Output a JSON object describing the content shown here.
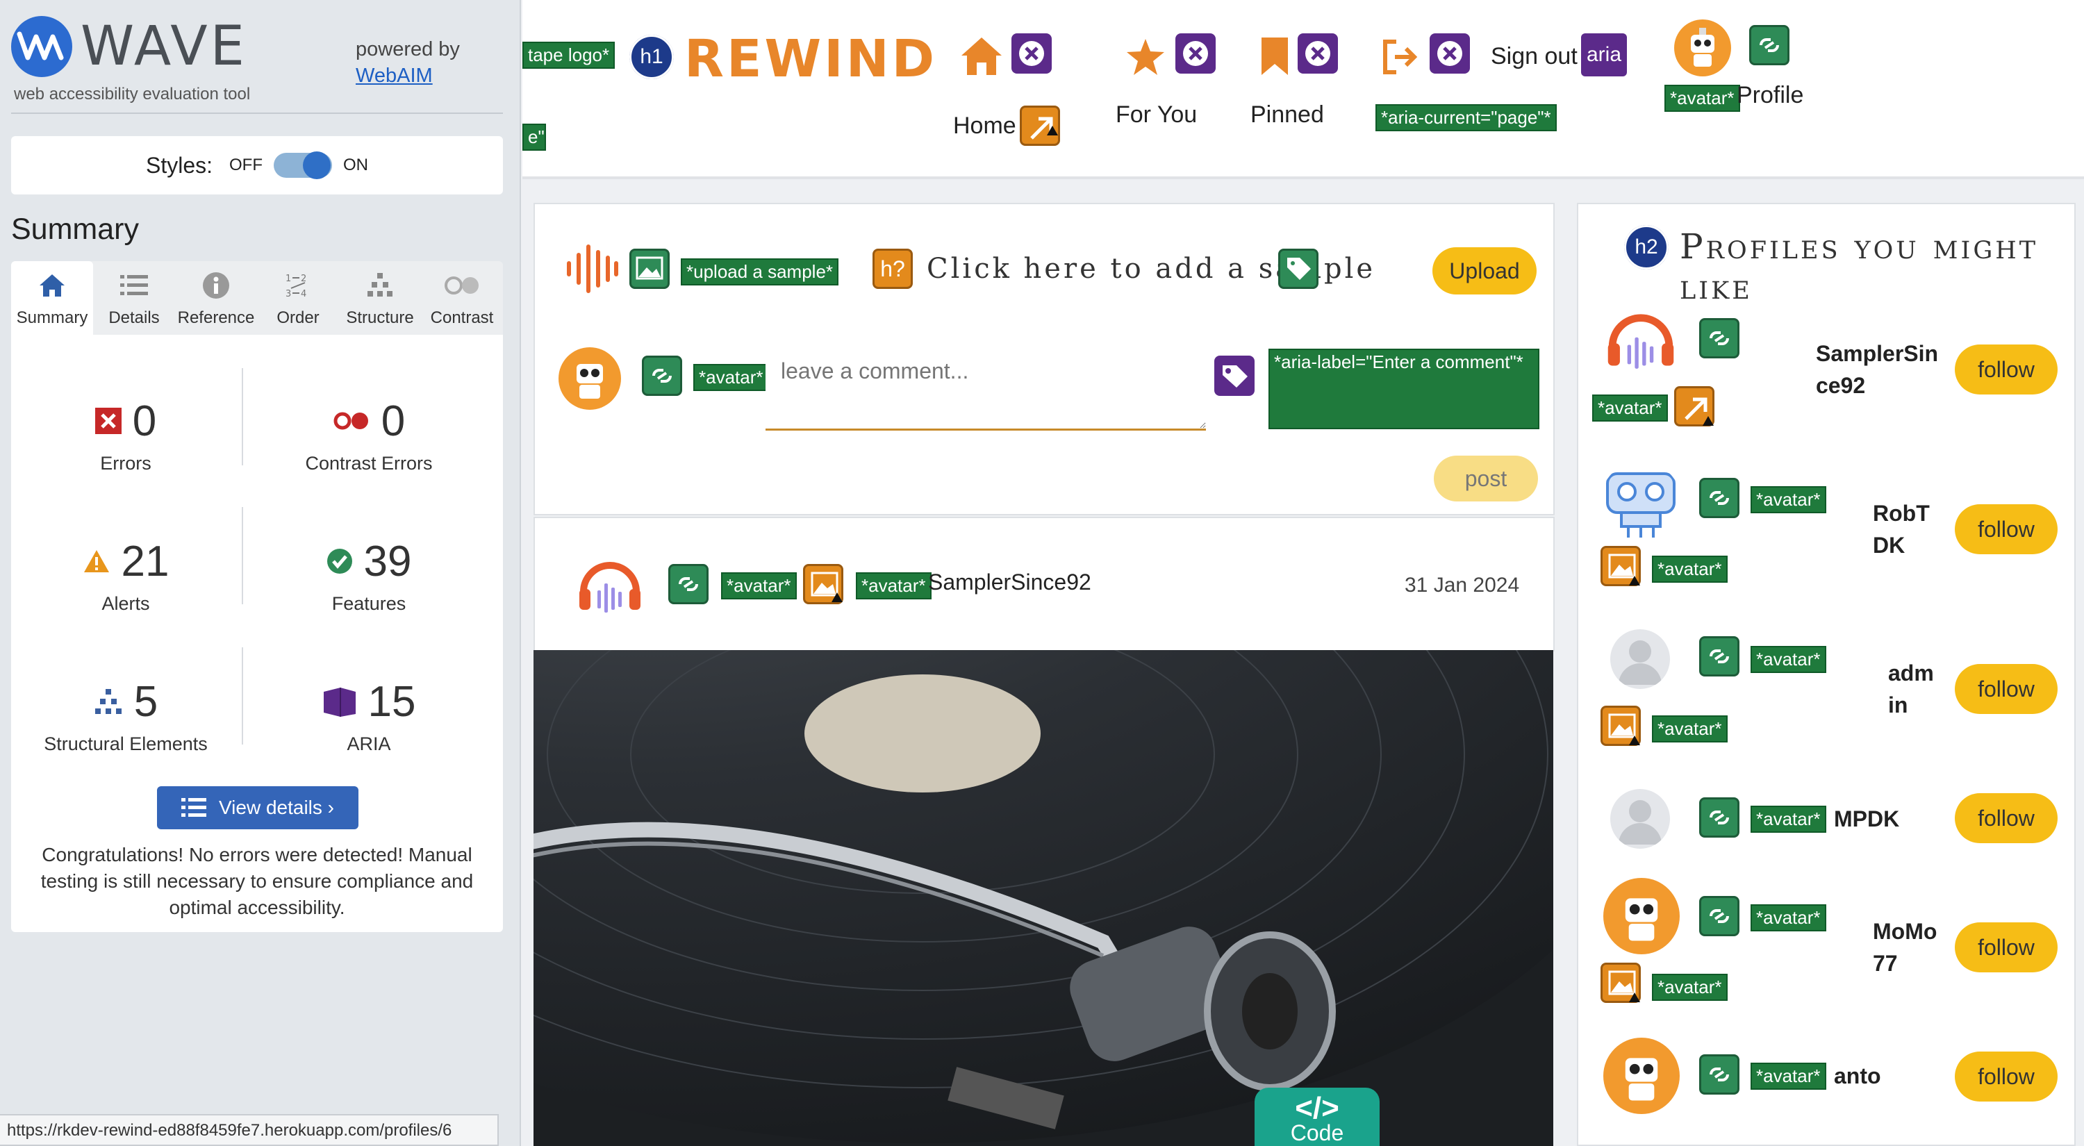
{
  "wave": {
    "brand": "WAVE",
    "subtitle": "web accessibility evaluation tool",
    "powered_by": "powered by",
    "powered_link": "WebAIM",
    "styles_label": "Styles:",
    "styles_off": "OFF",
    "styles_on": "ON",
    "summary_title": "Summary",
    "tabs": [
      {
        "label": "Summary"
      },
      {
        "label": "Details"
      },
      {
        "label": "Reference"
      },
      {
        "label": "Order"
      },
      {
        "label": "Structure"
      },
      {
        "label": "Contrast"
      }
    ],
    "stats": {
      "errors": {
        "value": "0",
        "label": "Errors"
      },
      "contrast": {
        "value": "0",
        "label": "Contrast Errors"
      },
      "alerts": {
        "value": "21",
        "label": "Alerts"
      },
      "features": {
        "value": "39",
        "label": "Features"
      },
      "structural": {
        "value": "5",
        "label": "Structural Elements"
      },
      "aria": {
        "value": "15",
        "label": "ARIA"
      }
    },
    "view_details": "View details ›",
    "congrats": "Congratulations! No errors were detected! Manual testing is still necessary to ensure compliance and optimal accessibility.",
    "status_url": "https://rkdev-rewind-ed88f8459fe7.herokuapp.com/profiles/6"
  },
  "nav": {
    "tape_logo_tag": "tape logo*",
    "clipped_tag": "e\"*",
    "h1_tag": "h1",
    "brand": "REWIND",
    "home": "Home",
    "for_you": "For You",
    "pinned": "Pinned",
    "sign_out": "Sign out",
    "aria_tag": "aria",
    "aria_current_tag": "*aria-current=\"page\"*",
    "avatar_tag": "*avatar*",
    "profile": "Profile"
  },
  "upload": {
    "upload_tag": "*upload a sample*",
    "heading_tag": "h?",
    "prompt": "Click here to add a sample",
    "upload_button": "Upload",
    "avatar_tag": "*avatar*",
    "comment_placeholder": "leave a comment...",
    "aria_label_tag": "*aria-label=\"Enter a comment\"*",
    "post_button": "post"
  },
  "post": {
    "avatar_tag_1": "*avatar*",
    "avatar_tag_2": "*avatar*",
    "author": "SamplerSince92",
    "date": "31 Jan 2024",
    "code_label": "Code"
  },
  "profiles": {
    "heading_tag": "h2",
    "title": "Profiles you might like",
    "follow_label": "follow",
    "avatar_tag": "*avatar*",
    "items": [
      {
        "name_line1": "SamplerSin",
        "name_line2": "ce92"
      },
      {
        "name_line1": "RobT",
        "name_line2": "DK"
      },
      {
        "name_line1": "adm",
        "name_line2": "in"
      },
      {
        "name_line1": "MPDK",
        "name_line2": ""
      },
      {
        "name_line1": "MoMo",
        "name_line2": "77"
      },
      {
        "name_line1": "anto",
        "name_line2": ""
      }
    ]
  },
  "colors": {
    "wave_blue": "#2c6bd0",
    "rewind_orange": "#e8862a",
    "follow_yellow": "#f6bd16",
    "wave_tag_green": "#1f7a3c",
    "aria_purple": "#5b2a8a"
  }
}
